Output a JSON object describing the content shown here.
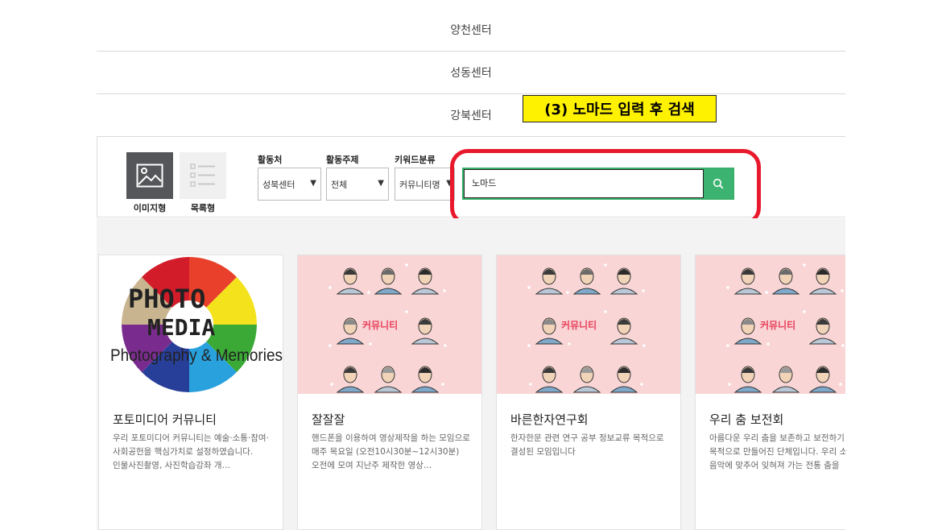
{
  "center_list": [
    "양천센터",
    "성동센터",
    "강북센터"
  ],
  "callout": {
    "text": "(3) 노마드 입력 후 검색",
    "bg_color": "#fff200"
  },
  "highlight_color": "#e8192c",
  "view_toggle": {
    "image_label": "이미지형",
    "list_label": "목록형"
  },
  "filters": {
    "location": {
      "label": "활동처",
      "value": "성북센터"
    },
    "topic": {
      "label": "활동주제",
      "value": "전체"
    },
    "keyword_type": {
      "label": "키워드분류",
      "value": "커뮤니티명"
    }
  },
  "search": {
    "value": "노마드",
    "icon": "search-icon",
    "button_color": "#3cb371"
  },
  "cards": [
    {
      "title": "포토미디어 커뮤니티",
      "description": "우리 포토미디어 커뮤니티는 예술·소통·참여·사회공헌을 핵심가치로 설정하였습니다. 인물사진촬영, 사진학습강좌 개…",
      "thumb_text": [
        "PHOTO",
        "MEDIA",
        "Photography & Memories"
      ]
    },
    {
      "title": "잘잘잘",
      "description": "핸드폰을 이용하여 영상제작을 하는 모임으로 매주 목요일 (오전10시30분~12시30분)오전에 모여 지난주 제작한 영상…",
      "thumb_text": [
        "커뮤니티"
      ]
    },
    {
      "title": "바른한자연구회",
      "description": "한자한문 관련 연구 공부 정보교류 목적으로 결성된 모임입니다",
      "thumb_text": [
        "커뮤니티"
      ]
    },
    {
      "title": "우리 춤 보전회",
      "description": "아름다운 우리 춤을 보존하고 보전하기 위한 목적으로 만들어진 단체입니다. 우리 소리 음악에 맞추어 잊혀져 가는 전통 춤을",
      "thumb_text": [
        "커뮤니티"
      ]
    }
  ]
}
